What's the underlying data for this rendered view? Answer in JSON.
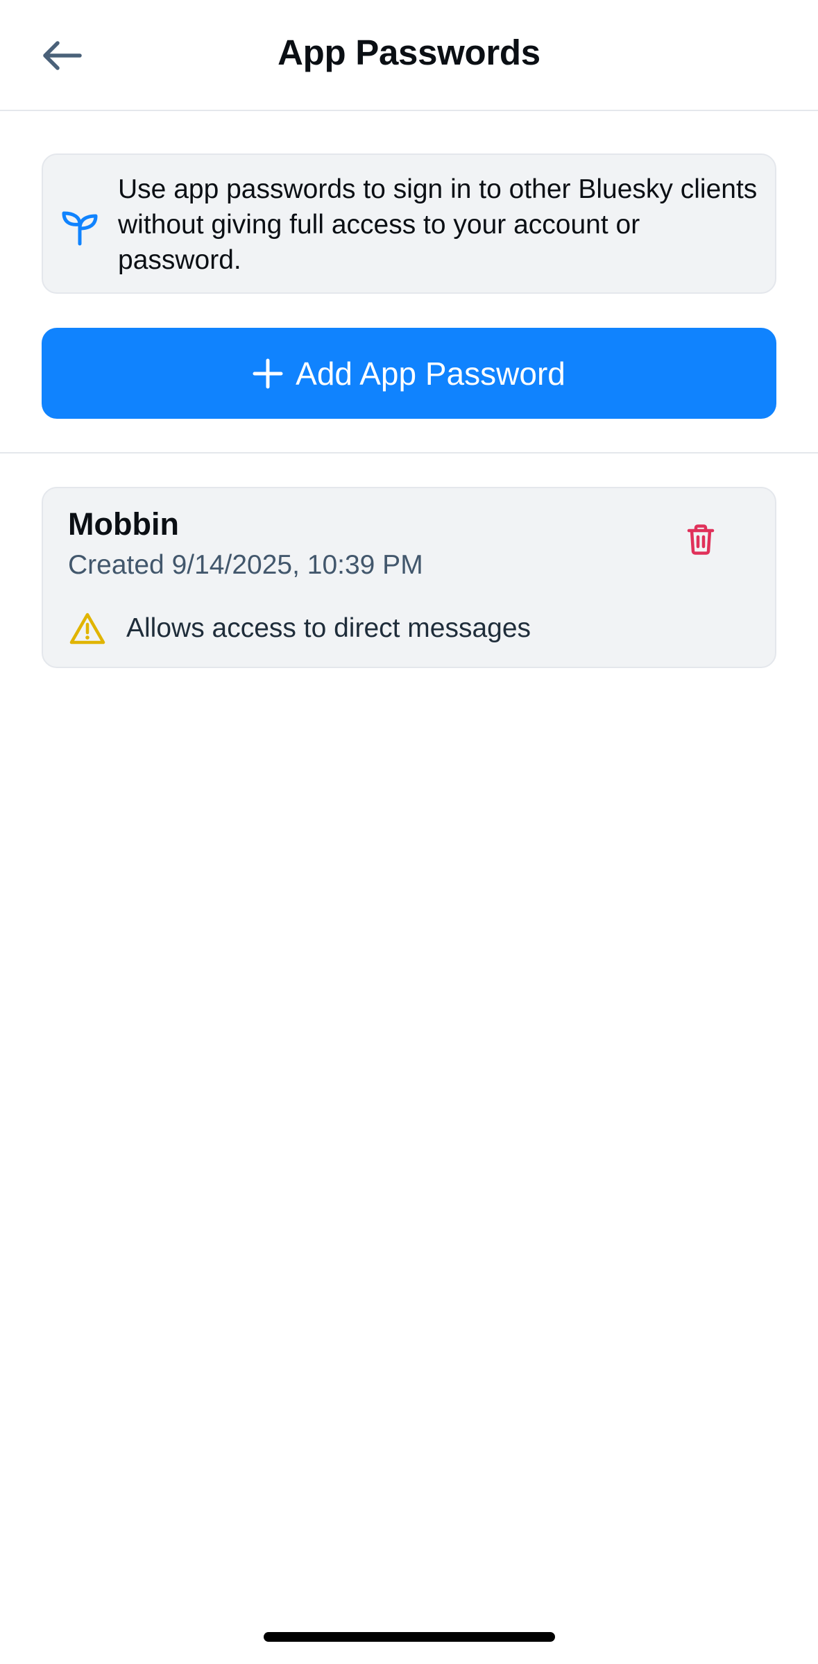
{
  "header": {
    "title": "App Passwords",
    "back_icon": "arrow-left-icon"
  },
  "info": {
    "icon": "sprout-icon",
    "text": "Use app passwords to sign in to other Bluesky clients without giving full access to your account or password."
  },
  "add_button": {
    "icon": "plus-icon",
    "label": "Add App Password"
  },
  "passwords": [
    {
      "name": "Mobbin",
      "created": "Created 9/14/2025, 10:39 PM",
      "warning_icon": "warning-triangle-icon",
      "warning": "Allows access to direct messages",
      "delete_icon": "trash-icon"
    }
  ],
  "colors": {
    "accent": "#1083fe",
    "danger": "#e0315a",
    "warning": "#e0b400",
    "card_bg": "#f1f3f5",
    "muted_text": "#42576c"
  }
}
